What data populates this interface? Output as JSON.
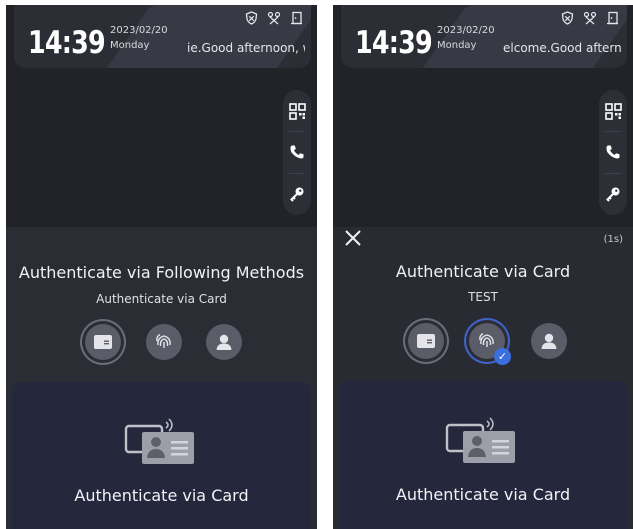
{
  "screens": [
    {
      "time": "14:39",
      "date": "2023/02/20",
      "weekday": "Monday",
      "welcome": "ie.Good afternoon, w",
      "auth_title": "Authenticate via Following Methods",
      "auth_subtitle": "Authenticate via Card",
      "card_label": "Authenticate via Card"
    },
    {
      "time": "14:39",
      "date": "2023/02/20",
      "weekday": "Monday",
      "welcome": "elcome.Good afterno",
      "countdown": "(1s)",
      "auth_title": "Authenticate via Card",
      "auth_subtitle": "TEST",
      "card_label": "Authenticate via Card"
    }
  ],
  "icons": {
    "status": [
      "shield-icon",
      "network-icon",
      "door-icon"
    ],
    "tools": [
      "qr-code-icon",
      "phone-icon",
      "key-icon"
    ],
    "methods": [
      "card-icon",
      "fingerprint-icon",
      "face-icon"
    ]
  },
  "colors": {
    "background": "#222329",
    "top_bar": "#2c2e36",
    "card_panel": "#25273d",
    "selected_ring": "#3e63c9",
    "check_badge": "#3b6fe0"
  }
}
